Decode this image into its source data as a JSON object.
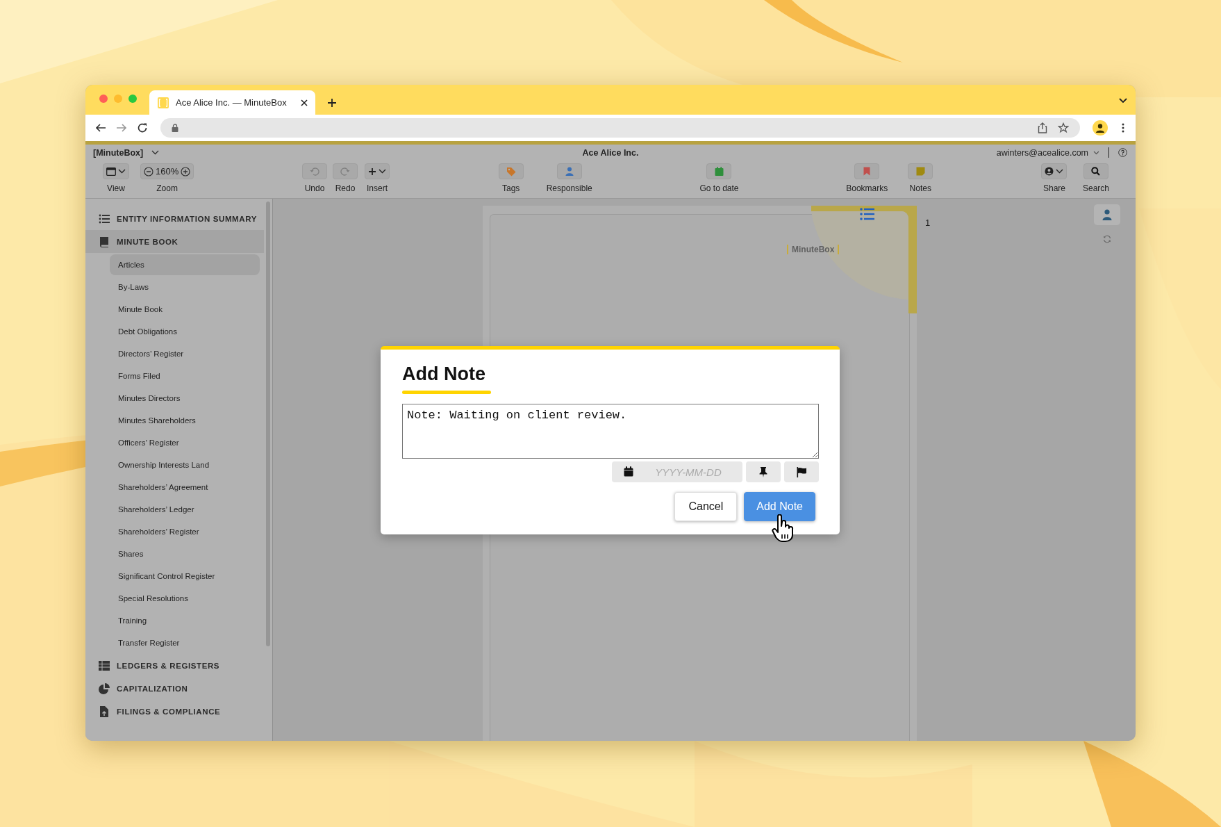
{
  "browser": {
    "tab": {
      "title": "Ace Alice Inc. — MinuteBox"
    }
  },
  "app_header": {
    "workspace": "[MinuteBox]",
    "title": "Ace Alice Inc.",
    "user": "awinters@acealice.com"
  },
  "toolbar_groups": [
    {
      "items": [
        {
          "kind": "view",
          "label": "View",
          "disabled": false
        },
        {
          "kind": "zoom",
          "label": "Zoom",
          "value": "160%",
          "disabled": false
        }
      ]
    },
    {
      "items": [
        {
          "kind": "undo",
          "label": "Undo",
          "disabled": true
        },
        {
          "kind": "redo",
          "label": "Redo",
          "disabled": true
        },
        {
          "kind": "insert",
          "label": "Insert",
          "disabled": false
        }
      ]
    },
    {
      "items": [
        {
          "kind": "tags",
          "label": "Tags",
          "disabled": false
        },
        {
          "kind": "responsible",
          "label": "Responsible",
          "disabled": false
        }
      ]
    },
    {
      "items": [
        {
          "kind": "date",
          "label": "Go to date",
          "disabled": false
        }
      ]
    },
    {
      "items": [
        {
          "kind": "bookmarks",
          "label": "Bookmarks",
          "disabled": false
        },
        {
          "kind": "notes",
          "label": "Notes",
          "disabled": false
        }
      ]
    },
    {
      "items": [
        {
          "kind": "share",
          "label": "Share",
          "disabled": false
        },
        {
          "kind": "search",
          "label": "Search",
          "disabled": false
        }
      ]
    }
  ],
  "sidebar": {
    "sections": [
      {
        "kind": "summary",
        "label": "ENTITY INFORMATION SUMMARY",
        "selected": false
      },
      {
        "kind": "book",
        "label": "MINUTE BOOK",
        "selected": true,
        "children": [
          {
            "label": "Articles",
            "selected": true
          },
          {
            "label": "By-Laws",
            "selected": false
          },
          {
            "label": "Minute Book",
            "selected": false
          },
          {
            "label": "Debt Obligations",
            "selected": false
          },
          {
            "label": "Directors’ Register",
            "selected": false
          },
          {
            "label": "Forms Filed",
            "selected": false
          },
          {
            "label": "Minutes Directors",
            "selected": false
          },
          {
            "label": "Minutes Shareholders",
            "selected": false
          },
          {
            "label": "Officers’ Register",
            "selected": false
          },
          {
            "label": "Ownership Interests Land",
            "selected": false
          },
          {
            "label": "Shareholders’ Agreement",
            "selected": false
          },
          {
            "label": "Shareholders’ Ledger",
            "selected": false
          },
          {
            "label": "Shareholders’ Register",
            "selected": false
          },
          {
            "label": "Shares",
            "selected": false
          },
          {
            "label": "Significant Control Register",
            "selected": false
          },
          {
            "label": "Special Resolutions",
            "selected": false
          },
          {
            "label": "Training",
            "selected": false
          },
          {
            "label": "Transfer Register",
            "selected": false
          }
        ]
      },
      {
        "kind": "ledgers",
        "label": "LEDGERS & REGISTERS",
        "selected": false
      },
      {
        "kind": "capitalization",
        "label": "CAPITALIZATION",
        "selected": false
      },
      {
        "kind": "filings",
        "label": "FILINGS & COMPLIANCE",
        "selected": false
      }
    ]
  },
  "document": {
    "logo": "MinuteBox",
    "page_number": "1"
  },
  "dialog": {
    "title": "Add Note",
    "note": {
      "value": "Note: Waiting on client review."
    },
    "date": {
      "placeholder": "YYYY-MM-DD"
    },
    "buttons": [
      {
        "kind": "secondary",
        "label": "Cancel"
      },
      {
        "kind": "primary",
        "label": "Add Note"
      }
    ]
  }
}
